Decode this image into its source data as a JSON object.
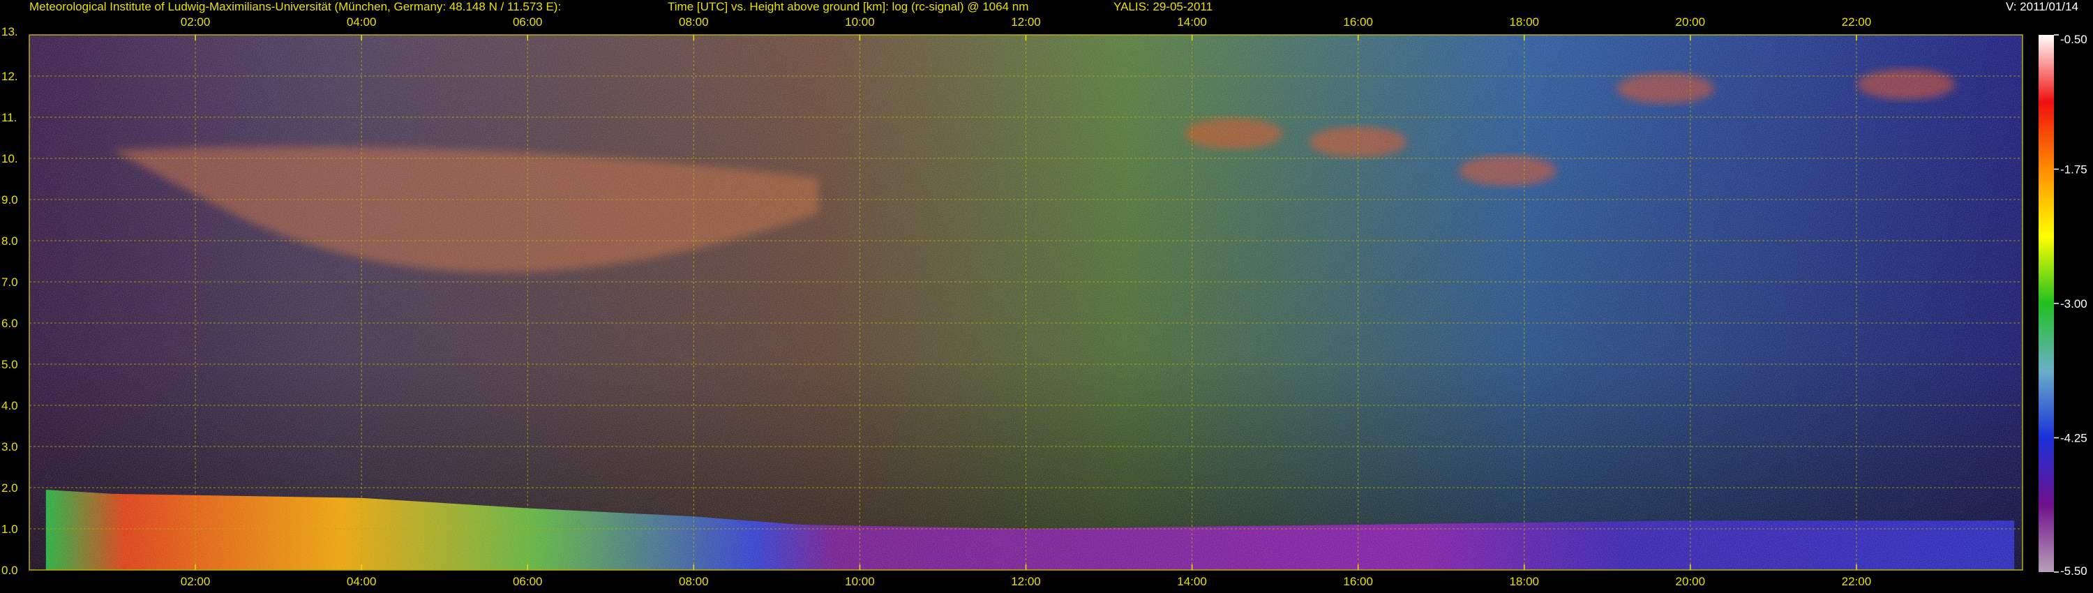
{
  "header": {
    "institute": "Meteorological Institute of Ludwig-Maximilians-Universität (München, Germany: 48.148 N / 11.573 E):",
    "description": "Time [UTC] vs. Height above ground [km]: log (rc-signal) @ 1064 nm",
    "instrument": "YALIS: 29-05-2011",
    "version": "V: 2011/01/14"
  },
  "chart_data": {
    "type": "heatmap",
    "x_ticks": [
      "02:00",
      "04:00",
      "06:00",
      "08:00",
      "10:00",
      "12:00",
      "14:00",
      "16:00",
      "18:00",
      "20:00",
      "22:00"
    ],
    "x_tick_hours": [
      2,
      4,
      6,
      8,
      10,
      12,
      14,
      16,
      18,
      20,
      22
    ],
    "xlim_hours": [
      0,
      24
    ],
    "y_ticks": [
      "13.",
      "12.",
      "11.",
      "10.",
      "9.0",
      "8.0",
      "7.0",
      "6.0",
      "5.0",
      "4.0",
      "3.0",
      "2.0",
      "1.0",
      "0.0"
    ],
    "y_tick_values": [
      13,
      12,
      11,
      10,
      9,
      8,
      7,
      6,
      5,
      4,
      3,
      2,
      1,
      0
    ],
    "ylim_km": [
      0,
      13
    ],
    "grid": true,
    "colorbar": {
      "ticks": [
        "-0.50",
        "-1.75",
        "-3.00",
        "-4.25",
        "-5.50"
      ],
      "tick_values": [
        -0.5,
        -1.75,
        -3.0,
        -4.25,
        -5.5
      ],
      "range": [
        -5.5,
        -0.5
      ]
    },
    "features": {
      "boundary_layer_top_km": [
        {
          "hour": 0.2,
          "km": 1.95
        },
        {
          "hour": 1.0,
          "km": 1.85
        },
        {
          "hour": 4.0,
          "km": 1.75
        },
        {
          "hour": 6.0,
          "km": 1.5
        },
        {
          "hour": 8.0,
          "km": 1.3
        },
        {
          "hour": 9.3,
          "km": 1.1
        },
        {
          "hour": 12.0,
          "km": 1.0
        },
        {
          "hour": 16.0,
          "km": 1.1
        },
        {
          "hour": 20.0,
          "km": 1.2
        },
        {
          "hour": 23.9,
          "km": 1.2
        }
      ],
      "cirrus_layer": {
        "hour_range": [
          1.0,
          9.5
        ],
        "km_range": [
          6.2,
          10.2
        ]
      },
      "upper_cloud_patches": [
        {
          "hour": 14.5,
          "km": 10.6
        },
        {
          "hour": 16.0,
          "km": 10.4
        },
        {
          "hour": 17.8,
          "km": 9.7
        },
        {
          "hour": 19.7,
          "km": 11.7
        },
        {
          "hour": 22.6,
          "km": 11.8
        }
      ]
    }
  },
  "colors": {
    "text": "#e8e100",
    "grid": "#b8b000",
    "background": "#000000",
    "colorbar_stops": [
      "#ffffff",
      "#f01010",
      "#ff8c00",
      "#ffff00",
      "#20c020",
      "#6ab0c8",
      "#1a30d8",
      "#70108c",
      "#b8a0b8"
    ]
  }
}
